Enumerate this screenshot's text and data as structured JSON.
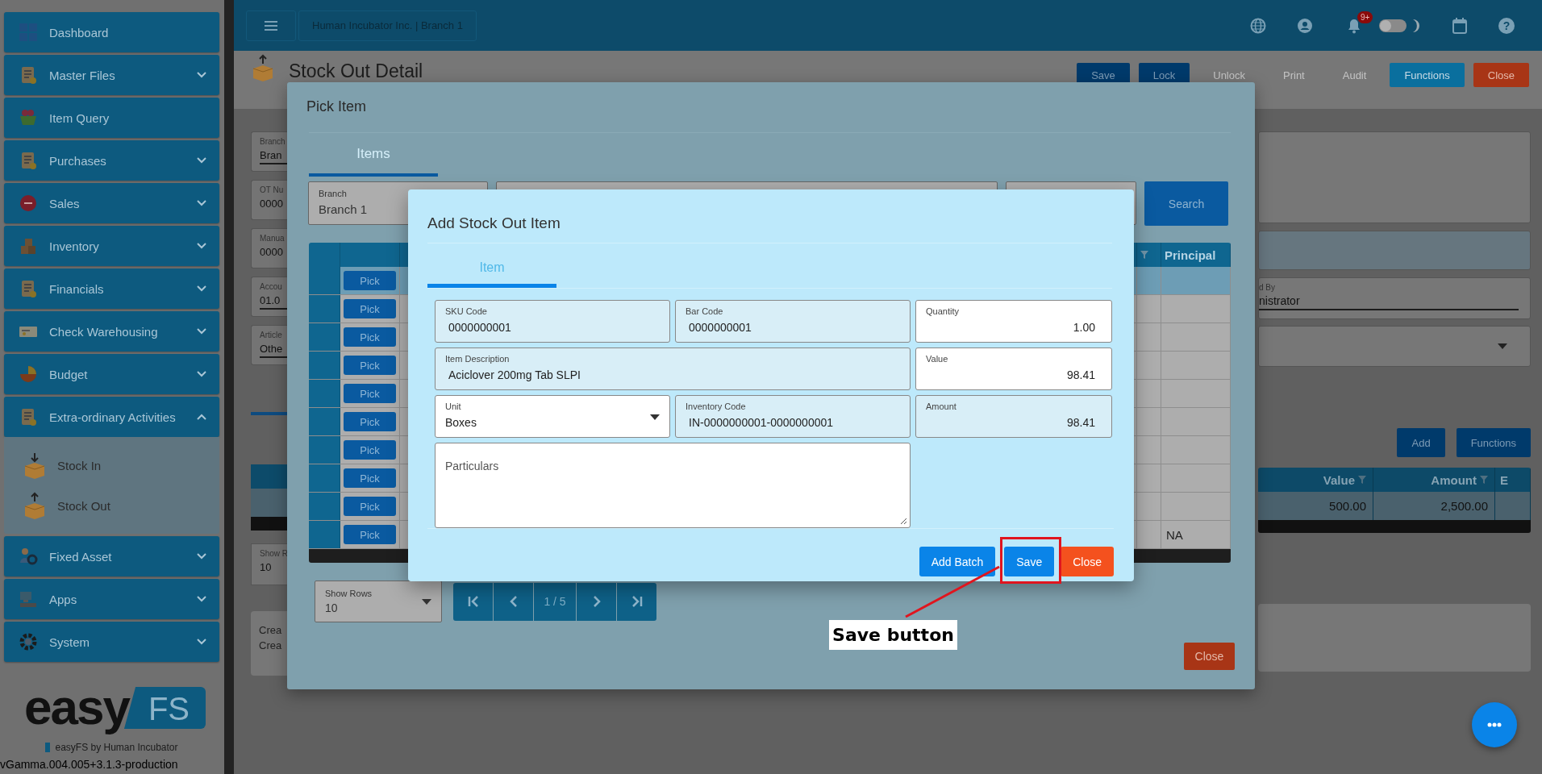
{
  "sidebar": {
    "items": [
      {
        "label": "Dashboard",
        "kind": "link"
      },
      {
        "label": "Master Files",
        "kind": "group",
        "expanded": false
      },
      {
        "label": "Item Query",
        "kind": "link"
      },
      {
        "label": "Purchases",
        "kind": "group",
        "expanded": false
      },
      {
        "label": "Sales",
        "kind": "group",
        "expanded": false
      },
      {
        "label": "Inventory",
        "kind": "group",
        "expanded": false
      },
      {
        "label": "Financials",
        "kind": "group",
        "expanded": false
      },
      {
        "label": "Check Warehousing",
        "kind": "group",
        "expanded": false
      },
      {
        "label": "Budget",
        "kind": "group",
        "expanded": false
      },
      {
        "label": "Extra-ordinary Activities",
        "kind": "group",
        "expanded": true,
        "children": [
          {
            "label": "Stock In"
          },
          {
            "label": "Stock Out"
          }
        ]
      },
      {
        "label": "Fixed Asset",
        "kind": "group",
        "expanded": false
      },
      {
        "label": "Apps",
        "kind": "group",
        "expanded": false
      },
      {
        "label": "System",
        "kind": "group",
        "expanded": false
      }
    ],
    "logo": {
      "word": "easy",
      "badge": "FS"
    },
    "tagline": "easyFS by Human Incubator",
    "version": "vGamma.004.005+3.1.3-production"
  },
  "topbar": {
    "company": "Human Incubator Inc. | Branch 1",
    "notification_badge": "9+",
    "dark_mode": false,
    "help_glyph": "?"
  },
  "page": {
    "title": "Stock Out Detail",
    "actions": [
      {
        "label": "Save",
        "kind": "primary"
      },
      {
        "label": "Lock",
        "kind": "primary"
      },
      {
        "label": "Unlock",
        "kind": "plain"
      },
      {
        "label": "Print",
        "kind": "plain"
      },
      {
        "label": "Audit",
        "kind": "plain"
      },
      {
        "label": "Functions",
        "kind": "secondary"
      },
      {
        "label": "Close",
        "kind": "danger"
      }
    ],
    "left_fields": [
      {
        "label": "Branch",
        "value": "Bran",
        "editable": true
      },
      {
        "label": "OT Nu",
        "value": "0000",
        "editable": false
      },
      {
        "label": "Manua",
        "value": "0000",
        "editable": false
      },
      {
        "label": "Accou",
        "value": "01.0",
        "editable": true
      },
      {
        "label": "Article",
        "value": "Othe",
        "editable": true
      }
    ],
    "show_rows": {
      "label": "Show R",
      "value": "10"
    },
    "created_lines": [
      "Crea",
      "Crea"
    ],
    "right_field": {
      "label": "d By",
      "value": "nistrator"
    },
    "detail_buttons": [
      {
        "label": "Add",
        "kind": "primary"
      },
      {
        "label": "Functions",
        "kind": "primary"
      }
    ],
    "detail_table": {
      "columns": [
        {
          "label": "Value",
          "filter": true
        },
        {
          "label": "Amount",
          "filter": true
        },
        {
          "label": "E",
          "filter": false
        }
      ],
      "rows": [
        [
          "500.00",
          "2,500.00"
        ]
      ]
    }
  },
  "pick_modal": {
    "title": "Pick Item",
    "tabs": [
      {
        "label": "Items",
        "selected": true
      }
    ],
    "filters": [
      {
        "label": "Branch",
        "value": "Branch 1"
      }
    ],
    "search_button": "Search",
    "table": {
      "columns": [
        {
          "filter": true
        },
        {
          "label": "Principal",
          "filter": false
        }
      ],
      "rows": [
        {
          "action": "Pick",
          "selected": true
        },
        {
          "action": "Pick",
          "selected": false
        },
        {
          "action": "Pick",
          "selected": false
        },
        {
          "action": "Pick",
          "selected": false
        },
        {
          "action": "Pick",
          "selected": false
        },
        {
          "action": "Pick",
          "selected": false
        },
        {
          "action": "Pick",
          "selected": false
        },
        {
          "action": "Pick",
          "selected": false
        },
        {
          "action": "Pick",
          "selected": false
        },
        {
          "action": "Pick",
          "selected": false,
          "principal": "NA"
        }
      ]
    },
    "show_rows": {
      "label": "Show Rows",
      "value": "10"
    },
    "pager": "1 / 5",
    "close_button": "Close"
  },
  "add_modal": {
    "title": "Add Stock Out Item",
    "tabs": [
      {
        "label": "Item",
        "selected": true
      }
    ],
    "item_fields": [
      {
        "label": "SKU Code",
        "value": "0000000001",
        "kind": "text",
        "editable": false
      },
      {
        "label": "Bar Code",
        "value": "0000000001",
        "kind": "text",
        "editable": false
      },
      {
        "label": "Item Description",
        "value": "Aciclover 200mg Tab SLPI",
        "kind": "long_text",
        "editable": false
      },
      {
        "label": "Unit",
        "value": "Boxes",
        "kind": "select",
        "editable": true
      },
      {
        "label": "Inventory Code",
        "value": "IN-0000000001-0000000001",
        "kind": "text",
        "editable": false
      },
      {
        "placeholder": "Particulars",
        "kind": "textarea",
        "editable": true
      }
    ],
    "amount_fields": [
      {
        "label": "Quantity",
        "value": "1.00",
        "kind": "number",
        "editable": true
      },
      {
        "label": "Value",
        "value": "98.41",
        "kind": "number",
        "editable": true
      },
      {
        "label": "Amount",
        "value": "98.41",
        "kind": "number",
        "editable": false
      }
    ],
    "buttons": [
      {
        "label": "Add Batch",
        "kind": "primary"
      },
      {
        "label": "Save",
        "kind": "primary"
      },
      {
        "label": "Close",
        "kind": "danger"
      }
    ]
  },
  "annotation": {
    "label": "Save button"
  }
}
